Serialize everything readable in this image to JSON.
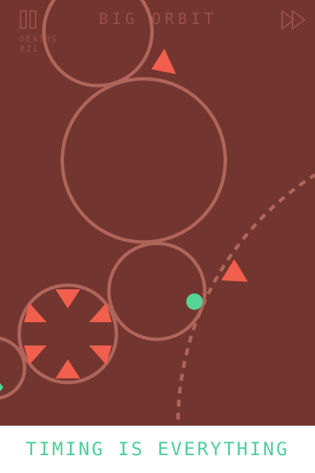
{
  "hud": {
    "level_title": "BIG ORBIT",
    "deaths_label": "DEATHS",
    "deaths_count": "021"
  },
  "banner": {
    "tagline": "TIMING IS EVERYTHING"
  },
  "colors": {
    "background": "#733530",
    "orbit_stroke": "#b0655a",
    "hazard": "#f25f4c",
    "player": "#55d596",
    "hud_text": "#9a5048",
    "tagline": "#4fcf9a"
  },
  "icons": {
    "pause": "pause-icon",
    "fast_forward": "fast-forward-icon"
  }
}
